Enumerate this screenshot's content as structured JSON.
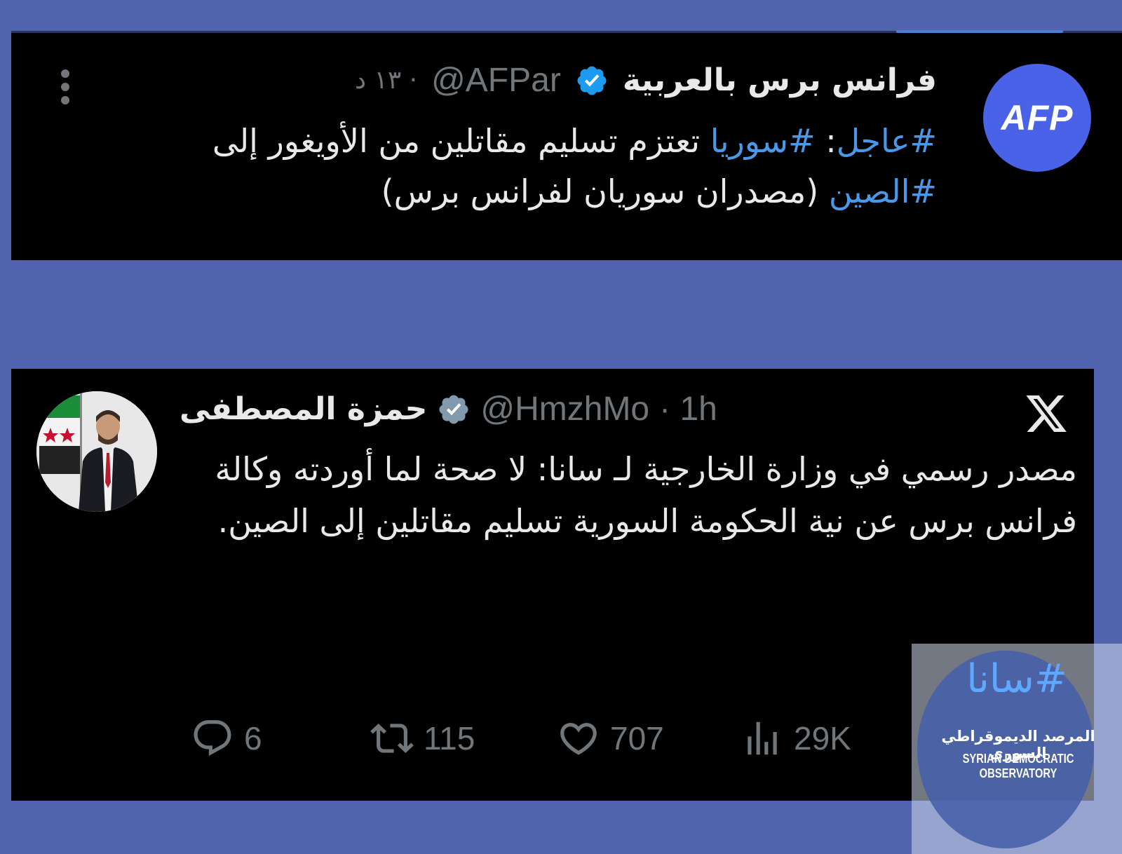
{
  "tweet1": {
    "avatar_text": "AFP",
    "name": "فرانس برس بالعربية",
    "handle": "@AFPar",
    "time": "· ١٣ د",
    "body_hashtag1": "#عاجل",
    "body_text1": ": ",
    "body_hashtag2": "#سوريا",
    "body_text2": " تعتزم تسليم مقاتلين من الأويغور إلى ",
    "body_hashtag3": "#الصين",
    "body_text3": " (مصدران سوريان لفرانس برس)",
    "badge_color": "#1d9bf0"
  },
  "tweet2": {
    "name": "حمزة المصطفى",
    "handle": "@HmzhMo",
    "time": "· 1h",
    "body": "مصدر رسمي في وزارة الخارجية لـ سانا: لا صحة لما أوردته وكالة فرانس برس عن نية الحكومة السورية تسليم مقاتلين إلى الصين.",
    "badge_color": "#829aab",
    "actions": {
      "replies": "6",
      "retweets": "115",
      "likes": "707",
      "views": "29K"
    }
  },
  "watermark": {
    "hashtag": "#سانا",
    "org_ar": "المرصد الديموقراطي السوري",
    "org_en": "SYRIAN DEMOCRATIC OBSERVATORY"
  }
}
